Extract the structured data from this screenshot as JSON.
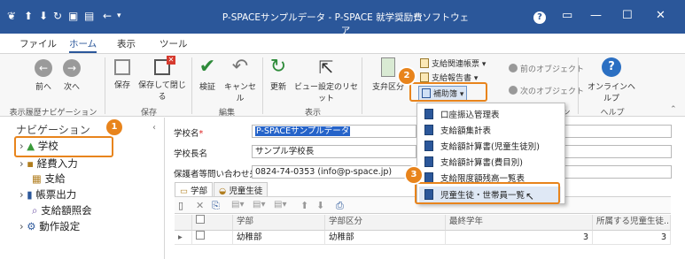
{
  "titlebar": {
    "title": "P-SPACEサンプルデータ - P-SPACE 就学奨励費ソフトウェア",
    "help": "?",
    "minimize": "—",
    "maximize": "☐",
    "close": "✕"
  },
  "ribbon_tabs": [
    "ファイル",
    "ホーム",
    "表示",
    "ツール"
  ],
  "ribbon": {
    "back": "前へ",
    "forward": "次へ",
    "save": "保存",
    "save_close": "保存して閉じる",
    "verify": "検証",
    "cancel": "キャンセル",
    "refresh": "更新",
    "view_reset": "ビュー設定のリセット",
    "payment_split": "支弁区分",
    "payment_sheets": "支給関連帳票",
    "payment_report": "支給報告書",
    "subsidy": "補助簿",
    "prev_object": "前のオブジェクト",
    "next_object": "次のオブジェクト",
    "online_help": "オンラインヘルプ",
    "groups": {
      "history": "表示履歴ナビゲーション",
      "save": "保存",
      "edit": "編集",
      "view": "表示",
      "action": "ション",
      "help": "ヘルプ"
    }
  },
  "nav": {
    "title": "ナビゲーション",
    "items": [
      "学校",
      "経費入力",
      "支給",
      "帳票出力",
      "支給額照会",
      "動作設定"
    ]
  },
  "form": {
    "school_name_label": "学校名",
    "required_mark": "*",
    "school_name_value": "P-SPACEサンプルデータ",
    "principal_label": "学校長名",
    "principal_value": "サンプル学校長",
    "contact_label": "保護者等問い合わせ先",
    "contact_value": "0824-74-0353 (info@p-space.jp)"
  },
  "subtabs": [
    "学部",
    "児童生徒"
  ],
  "grid": {
    "headers": [
      "学部",
      "学部区分",
      "最終学年",
      "所属する児童生徒..."
    ],
    "rows": [
      {
        "dept": "幼稚部",
        "dept_class": "幼稚部",
        "final_grade": "3",
        "students": "3"
      }
    ]
  },
  "dropdown": {
    "items": [
      "口座振込管理表",
      "支給額集計表",
      "支給額計算書(児童生徒別)",
      "支給額計算書(費目別)",
      "支給限度額残高一覧表",
      "児童生徒・世帯員一覧"
    ]
  },
  "callouts": [
    "1",
    "2",
    "3"
  ],
  "colors": {
    "titlebar": "#2b579a",
    "accent": "#2b579a",
    "callout": "#e8841c",
    "selection": "#2563c9"
  }
}
